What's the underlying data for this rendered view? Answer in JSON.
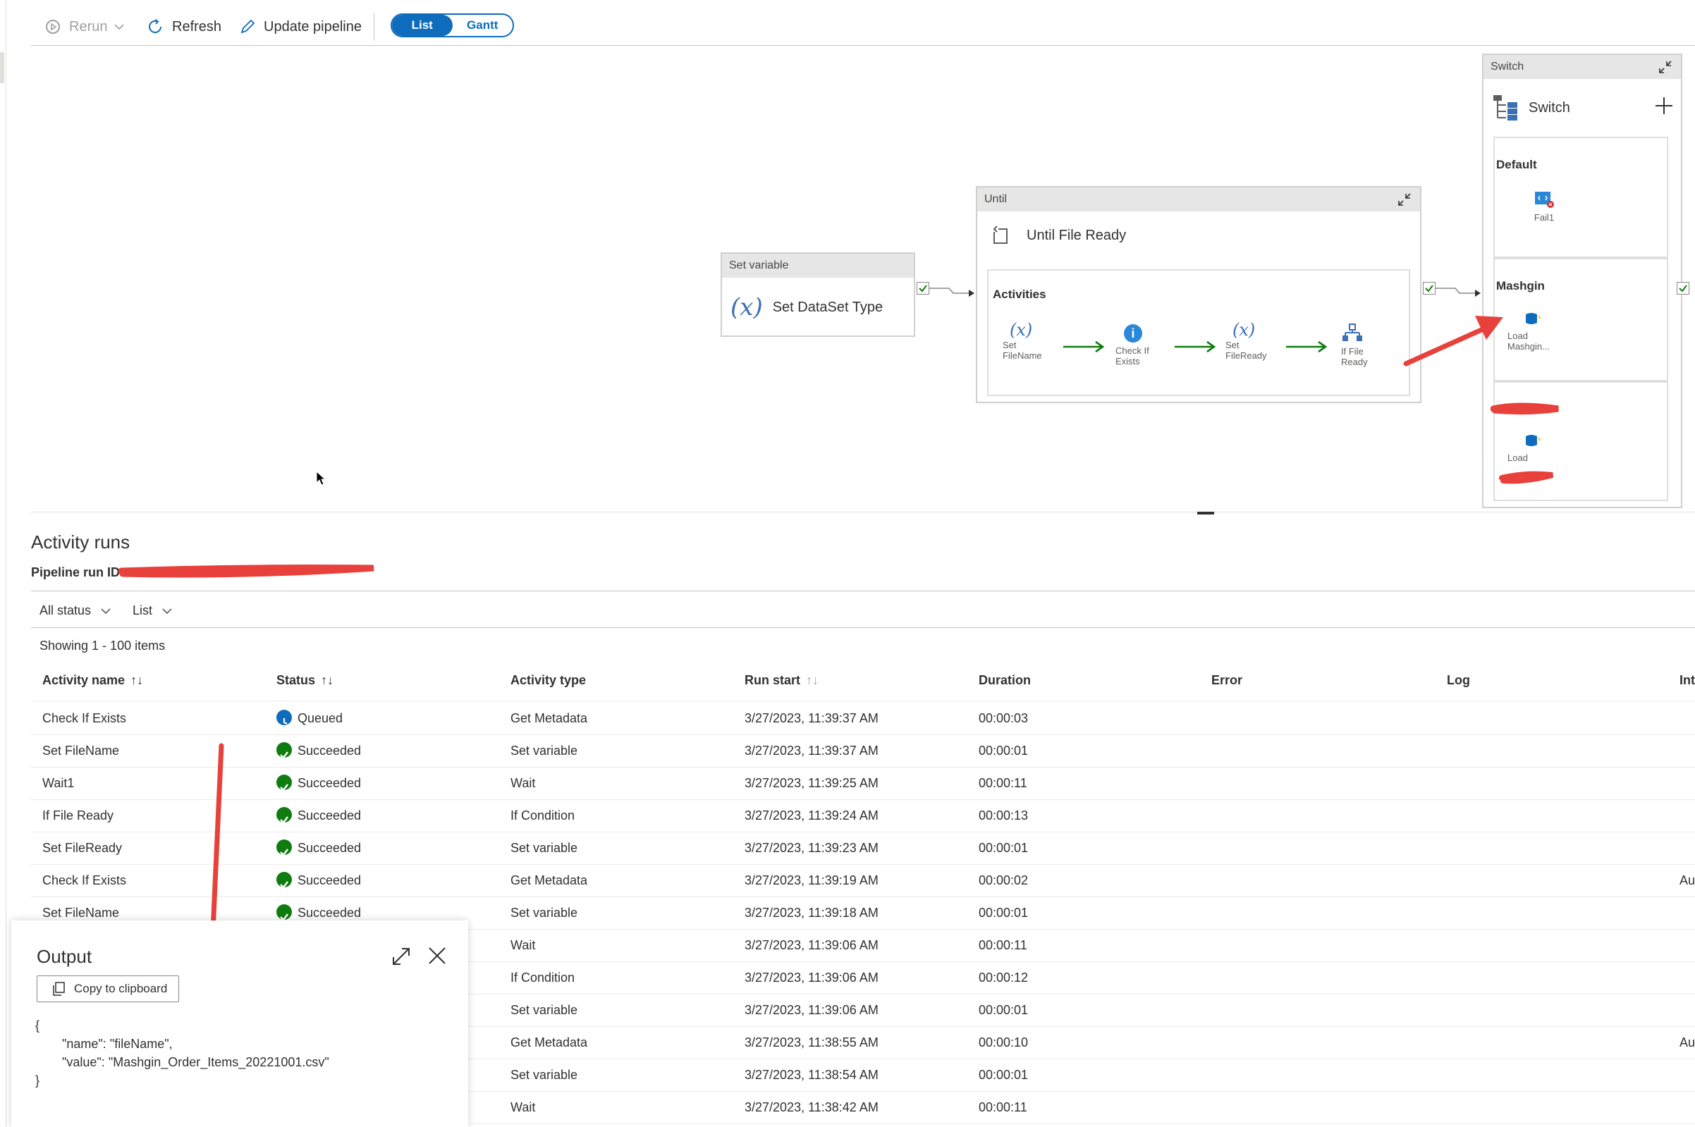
{
  "toolbar": {
    "rerun": "Rerun",
    "refresh": "Refresh",
    "update_pipeline": "Update pipeline",
    "view_list": "List",
    "view_gantt": "Gantt"
  },
  "canvas": {
    "set_variable": {
      "header": "Set variable",
      "name": "Set DataSet Type"
    },
    "until": {
      "header": "Until",
      "name": "Until File Ready",
      "activities_label": "Activities",
      "steps": [
        {
          "line1": "Set",
          "line2": "FileName",
          "icon": "variable-icon"
        },
        {
          "line1": "Check If",
          "line2": "Exists",
          "icon": "info-icon"
        },
        {
          "line1": "Set",
          "line2": "FileReady",
          "icon": "variable-icon"
        },
        {
          "line1": "If File",
          "line2": "Ready",
          "icon": "if-condition-icon"
        }
      ]
    },
    "switch": {
      "header": "Switch",
      "name": "Switch",
      "cases": [
        {
          "label": "Default",
          "activity": "Fail1",
          "icon": "fail-icon"
        },
        {
          "label": "Mashgin",
          "activity_line1": "Load",
          "activity_line2": "Mashgin...",
          "icon": "copy-icon"
        },
        {
          "label": "",
          "activity_line1": "Load",
          "icon": "copy-icon"
        }
      ]
    }
  },
  "activity_runs": {
    "title": "Activity runs",
    "pipeline_run_label": "Pipeline run ID",
    "filter_status": "All status",
    "filter_view": "List",
    "showing": "Showing 1 - 100 items",
    "columns": [
      "Activity name",
      "Status",
      "Activity type",
      "Run start",
      "Duration",
      "Error",
      "Log",
      "Inte"
    ],
    "rows": [
      {
        "name": "Check If Exists",
        "status": "Queued",
        "type": "Get Metadata",
        "start": "3/27/2023, 11:39:37 AM",
        "duration": "00:00:03",
        "extra": ""
      },
      {
        "name": "Set FileName",
        "status": "Succeeded",
        "type": "Set variable",
        "start": "3/27/2023, 11:39:37 AM",
        "duration": "00:00:01",
        "extra": ""
      },
      {
        "name": "Wait1",
        "status": "Succeeded",
        "type": "Wait",
        "start": "3/27/2023, 11:39:25 AM",
        "duration": "00:00:11",
        "extra": ""
      },
      {
        "name": "If File Ready",
        "status": "Succeeded",
        "type": "If Condition",
        "start": "3/27/2023, 11:39:24 AM",
        "duration": "00:00:13",
        "extra": ""
      },
      {
        "name": "Set FileReady",
        "status": "Succeeded",
        "type": "Set variable",
        "start": "3/27/2023, 11:39:23 AM",
        "duration": "00:00:01",
        "extra": ""
      },
      {
        "name": "Check If Exists",
        "status": "Succeeded",
        "type": "Get Metadata",
        "start": "3/27/2023, 11:39:19 AM",
        "duration": "00:00:02",
        "extra": "Aut"
      },
      {
        "name": "Set FileName",
        "status": "Succeeded",
        "type": "Set variable",
        "start": "3/27/2023, 11:39:18 AM",
        "duration": "00:00:01",
        "extra": ""
      },
      {
        "name": "",
        "status": "",
        "type": "Wait",
        "start": "3/27/2023, 11:39:06 AM",
        "duration": "00:00:11",
        "extra": ""
      },
      {
        "name": "",
        "status": "",
        "type": "If Condition",
        "start": "3/27/2023, 11:39:06 AM",
        "duration": "00:00:12",
        "extra": ""
      },
      {
        "name": "",
        "status": "",
        "type": "Set variable",
        "start": "3/27/2023, 11:39:06 AM",
        "duration": "00:00:01",
        "extra": ""
      },
      {
        "name": "",
        "status": "",
        "type": "Get Metadata",
        "start": "3/27/2023, 11:38:55 AM",
        "duration": "00:00:10",
        "extra": "Aut"
      },
      {
        "name": "",
        "status": "",
        "type": "Set variable",
        "start": "3/27/2023, 11:38:54 AM",
        "duration": "00:00:01",
        "extra": ""
      },
      {
        "name": "",
        "status": "",
        "type": "Wait",
        "start": "3/27/2023, 11:38:42 AM",
        "duration": "00:00:11",
        "extra": ""
      }
    ]
  },
  "output_panel": {
    "title": "Output",
    "copy_label": "Copy to clipboard",
    "json_lines": [
      "{",
      "\"name\": \"fileName\",",
      "\"value\": \"Mashgin_Order_Items_20221001.csv\"",
      "}"
    ]
  },
  "colors": {
    "accent": "#0f6cbd",
    "success": "#107c10",
    "queued": "#0f6cbd",
    "annotation_red": "#e8403a",
    "arrow_green": "#107c10"
  }
}
